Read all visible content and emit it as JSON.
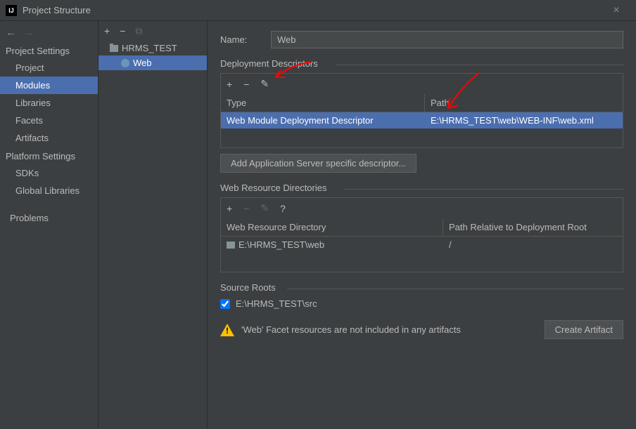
{
  "window": {
    "title": "Project Structure"
  },
  "nav": {
    "section1": "Project Settings",
    "items1": [
      "Project",
      "Modules",
      "Libraries",
      "Facets",
      "Artifacts"
    ],
    "section2": "Platform Settings",
    "items2": [
      "SDKs",
      "Global Libraries"
    ],
    "problems": "Problems"
  },
  "tree": {
    "root": "HRMS_TEST",
    "child": "Web"
  },
  "main": {
    "name_label": "Name:",
    "name_value": "Web",
    "deploy_title": "Deployment Descriptors",
    "deploy_th_type": "Type",
    "deploy_th_path": "Path",
    "deploy_row_type": "Web Module Deployment Descriptor",
    "deploy_row_path": "E:\\HRMS_TEST\\web\\WEB-INF\\web.xml",
    "add_server_btn": "Add Application Server specific descriptor...",
    "webres_title": "Web Resource Directories",
    "webres_th_dir": "Web Resource Directory",
    "webres_th_path": "Path Relative to Deployment Root",
    "webres_row_dir": "E:\\HRMS_TEST\\web",
    "webres_row_path": "/",
    "source_title": "Source Roots",
    "source_root": "E:\\HRMS_TEST\\src",
    "warn_msg": "'Web' Facet resources are not included in any artifacts",
    "create_artifact_btn": "Create Artifact"
  }
}
